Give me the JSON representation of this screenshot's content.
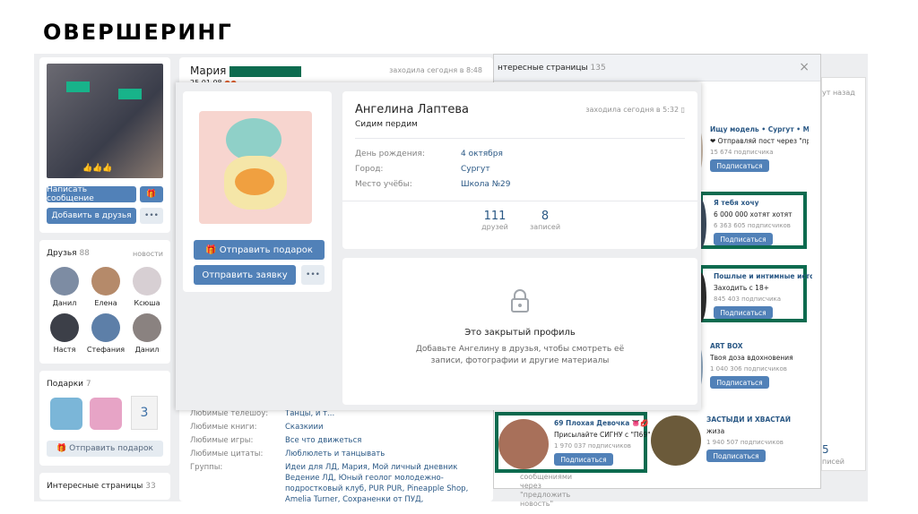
{
  "slide_title": "ОВЕРШЕРИНГ",
  "profile1": {
    "name": "Мария",
    "date": "25.01.08",
    "status": "заходила сегодня в 8:48",
    "photo_caption": "👍👍👍",
    "write_btn": "Написать сообщение",
    "add_btn": "Добавить в друзья",
    "more": "•••",
    "friends_label": "Друзья",
    "friends_count": "88",
    "news": "новости",
    "friends": [
      "Данил",
      "Елена",
      "Ксюша",
      "Настя",
      "Стефания",
      "Данил"
    ],
    "gifts_label": "Подарки",
    "gifts_count": "7",
    "send_gift": "Отправить подарок",
    "pages_label": "Интересные страницы",
    "pages_count": "33",
    "interests": [
      {
        "k": "Любимые телешоу:",
        "v": "Танцы, и т..."
      },
      {
        "k": "Любимые книги:",
        "v": "Сказкиии"
      },
      {
        "k": "Любимые игры:",
        "v": "Все что движеться"
      },
      {
        "k": "Любимые цитаты:",
        "v": "Люблюлеть и танцывать"
      },
      {
        "k": "Группы:",
        "v": "Идеи для ЛД, Мария, Мой личный дневник Ведение ЛД, Юный геолог молодежно-подростковый клуб, PUR PUR, Pineapple Shop, Amelia Turner, Сохраненки от ПУД,"
      }
    ]
  },
  "profile2": {
    "name": "Ангелина Лаптева",
    "status_text": "Сидим пердим",
    "online": "заходила сегодня в 5:32",
    "fields": [
      {
        "k": "День рождения:",
        "v": "4 октября"
      },
      {
        "k": "Город:",
        "v": "Сургут"
      },
      {
        "k": "Место учёбы:",
        "v": "Школа №29"
      }
    ],
    "friends_num": "111",
    "friends_lbl": "друзей",
    "posts_num": "8",
    "posts_lbl": "записей",
    "gift_btn": "Отправить подарок",
    "request_btn": "Отправить заявку",
    "more": "•••",
    "closed_title": "Это закрытый профиль",
    "closed_text": "Добавьте Ангелину в друзья, чтобы смотреть её записи, фотографии и другие материалы"
  },
  "pages_panel": {
    "header": "нтересные страницы",
    "count": "135",
    "close": "×",
    "top_right": "ут назад",
    "groups": [
      {
        "name": "Ищу модель • Сургут • Мас...",
        "desc": "❤ Отправляй пост через \"пр...",
        "subs": "15 674 подписчика"
      },
      {
        "name": "Я тебя хочу",
        "desc": "6 000 000 хотят хотят",
        "subs": "6 363 605 подписчиков"
      },
      {
        "name": "Пошлые и интимные исто...",
        "desc": "Заходить с 18+",
        "subs": "845 403 подписчика"
      },
      {
        "name": "ART BOX",
        "desc": "Твоя доза вдохновения",
        "subs": "1 040 306 подписчиков"
      },
      {
        "name": "69 Плохая Девочка 👅💋",
        "desc": "Присылайте СИГНУ с \"П69\"...",
        "subs": "1 970 037 подписчиков"
      },
      {
        "name": "ЗАСТЫДИ И ХВАСТАЙ",
        "desc": "жиза",
        "subs": "1 940 507 подписчиков"
      }
    ],
    "subscribe": "Подписаться",
    "bottom_num": "5",
    "bottom_lbl": "писей",
    "bottom_note": "сообщениями через \"предложить новость\""
  }
}
